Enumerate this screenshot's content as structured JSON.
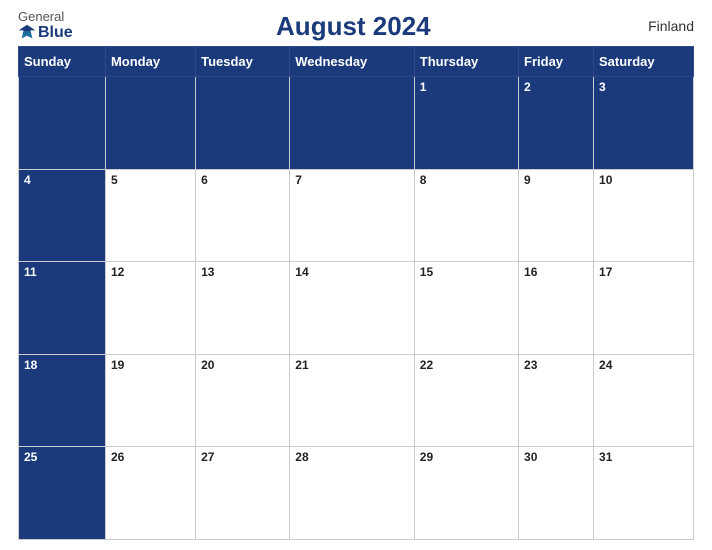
{
  "header": {
    "logo_general": "General",
    "logo_blue": "Blue",
    "title": "August 2024",
    "country": "Finland"
  },
  "weekdays": [
    "Sunday",
    "Monday",
    "Tuesday",
    "Wednesday",
    "Thursday",
    "Friday",
    "Saturday"
  ],
  "weeks": [
    [
      {
        "num": "",
        "blue": true
      },
      {
        "num": "",
        "blue": true
      },
      {
        "num": "",
        "blue": true
      },
      {
        "num": "",
        "blue": true
      },
      {
        "num": "1",
        "blue": true
      },
      {
        "num": "2",
        "blue": true
      },
      {
        "num": "3",
        "blue": true
      }
    ],
    [
      {
        "num": "4",
        "blue": true
      },
      {
        "num": "5",
        "blue": false
      },
      {
        "num": "6",
        "blue": false
      },
      {
        "num": "7",
        "blue": false
      },
      {
        "num": "8",
        "blue": false
      },
      {
        "num": "9",
        "blue": false
      },
      {
        "num": "10",
        "blue": false
      }
    ],
    [
      {
        "num": "11",
        "blue": true
      },
      {
        "num": "12",
        "blue": false
      },
      {
        "num": "13",
        "blue": false
      },
      {
        "num": "14",
        "blue": false
      },
      {
        "num": "15",
        "blue": false
      },
      {
        "num": "16",
        "blue": false
      },
      {
        "num": "17",
        "blue": false
      }
    ],
    [
      {
        "num": "18",
        "blue": true
      },
      {
        "num": "19",
        "blue": false
      },
      {
        "num": "20",
        "blue": false
      },
      {
        "num": "21",
        "blue": false
      },
      {
        "num": "22",
        "blue": false
      },
      {
        "num": "23",
        "blue": false
      },
      {
        "num": "24",
        "blue": false
      }
    ],
    [
      {
        "num": "25",
        "blue": true
      },
      {
        "num": "26",
        "blue": false
      },
      {
        "num": "27",
        "blue": false
      },
      {
        "num": "28",
        "blue": false
      },
      {
        "num": "29",
        "blue": false
      },
      {
        "num": "30",
        "blue": false
      },
      {
        "num": "31",
        "blue": false
      }
    ]
  ]
}
